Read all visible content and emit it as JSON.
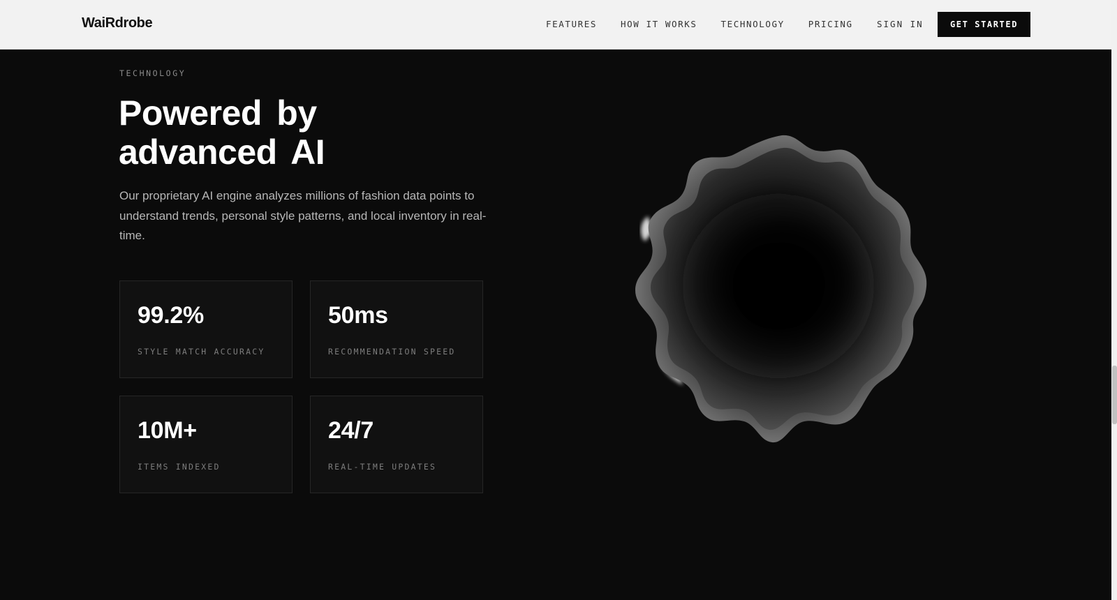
{
  "brand": {
    "logo_text": "WaiRdrobe"
  },
  "nav": {
    "items": [
      {
        "label": "FEATURES"
      },
      {
        "label": "HOW IT WORKS"
      },
      {
        "label": "TECHNOLOGY"
      },
      {
        "label": "PRICING"
      }
    ],
    "sign_in_label": "SIGN IN",
    "cta_label": "GET STARTED"
  },
  "section": {
    "eyebrow": "TECHNOLOGY",
    "headline_line1": "Powered by",
    "headline_line2": "advanced AI",
    "description": "Our proprietary AI engine analyzes millions of fashion data points to understand trends, personal style patterns, and local inventory in real-time."
  },
  "stats": [
    {
      "value": "99.2%",
      "label": "STYLE MATCH ACCURACY"
    },
    {
      "value": "50ms",
      "label": "RECOMMENDATION SPEED"
    },
    {
      "value": "10M+",
      "label": "ITEMS INDEXED"
    },
    {
      "value": "24/7",
      "label": "REAL-TIME UPDATES"
    }
  ],
  "colors": {
    "header_bg": "#f2f2f2",
    "page_bg": "#0b0b0b",
    "card_bg": "#111111",
    "card_border": "#262626",
    "text_primary": "#ffffff",
    "text_muted": "#b7b7b7",
    "cta_bg": "#0b0b0b"
  },
  "visual": {
    "icon": "organic-blob-shape"
  }
}
